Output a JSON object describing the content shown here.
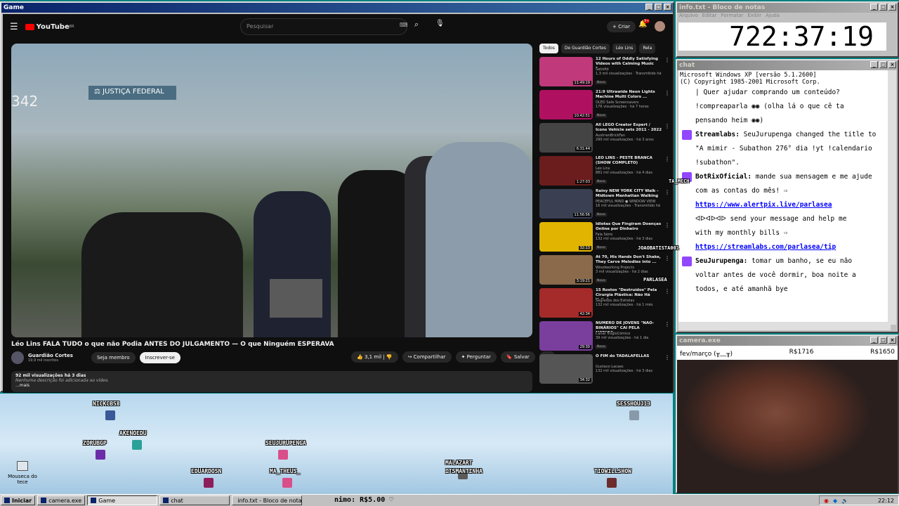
{
  "game_window": {
    "title": "Game"
  },
  "youtube": {
    "logo": "YouTube",
    "region": "BR",
    "search_placeholder": "Pesquisar",
    "create_label": "Criar",
    "notifications": "9+",
    "video_title": "Léo Lins FALA TUDO o que não Podia ANTES DO JULGAMENTO — O que Ninguém ESPERAVA",
    "channel": "Guardião Cortes",
    "subscribers": "19,9 mil inscritos",
    "member_label": "Seja membro",
    "subscribe_label": "Inscrever-se",
    "likes": "3,1 mil",
    "share_label": "Compartilhar",
    "ask_label": "Perguntar",
    "save_label": "Salvar",
    "views_line": "92 mil visualizações  há 3 dias",
    "no_desc": "Nenhuma descrição foi adicionada ao vídeo.",
    "more": "...mais",
    "chips": [
      "Todos",
      "De Guardião Cortes",
      "Léo Lins",
      "Rela"
    ],
    "recs": [
      {
        "title": "12 Hours of Oddly Satisfying Videos with Calming Music for...",
        "channel": "Satisfid",
        "stats": "1,3 mil visualizações · Transmitido há 1 dia",
        "badge": "Novo",
        "duration": "11:49:19",
        "color": "#c0397a"
      },
      {
        "title": "21:9 Ultrawide Neon Lights Machine Multi Colors ...",
        "channel": "OLED Safe Screensavers",
        "stats": "176 visualizações · há 7 horas",
        "badge": "Novo",
        "duration": "10:42:51",
        "color": "#b01060"
      },
      {
        "title": "All LEGO Creator Expert / Icons Vehicle sets 2011 - 2022 ...",
        "channel": "AustrianBrickFan",
        "stats": "290 mil visualizações · há 3 anos",
        "badge": "",
        "duration": "6:31:44",
        "color": "#444"
      },
      {
        "title": "LÉO LINS - PESTE BRANCA (SHOW COMPLETO)",
        "channel": "Léo Lins",
        "stats": "881 mil visualizações · há 4 dias",
        "badge": "Novo",
        "duration": "1:27:03",
        "color": "#6b1d1d"
      },
      {
        "title": "Rainy NEW YORK CITY Walk - Midtown Manhattan Walking ...",
        "channel": "PEACEFUL MIND ● WINDOW VIEW",
        "stats": "16 mil visualizações · Transmitido há 8 h",
        "badge": "Novo",
        "duration": "11:56:56",
        "color": "#3a3f52"
      },
      {
        "title": "Idiotas Que Fingiram Doenças Online por Dinheiro",
        "channel": "Fala Sério",
        "stats": "132 mil visualizações · há 3 dias",
        "badge": "Novo",
        "duration": "32:13",
        "color": "#e0b400"
      },
      {
        "title": "At 70, His Hands Don't Shake, They Carve Melodies into ...",
        "channel": "Woodworking Projects",
        "stats": "3 mil visualizações · há 2 dias",
        "badge": "Novo",
        "duration": "3:19:21",
        "color": "#8a6a4a"
      },
      {
        "title": "15 Rostos \"Destruídos\" Pela Cirurgia Plástica: Não Há Volta!",
        "channel": "Segredos dos Estrelas",
        "stats": "132 mil visualizações · há 1 mês",
        "badge": "",
        "duration": "42:34",
        "color": "#a52a2a"
      },
      {
        "title": "NÚMERO DE JOVENS \"NÃO-BINÁRIOS\" CAI PELA METADE...",
        "channel": "Canal TrogloCômico",
        "stats": "39 mil visualizações · há 1 dia",
        "badge": "Novo",
        "duration": "29:30",
        "color": "#7a3e9d"
      },
      {
        "title": "O FIM do TADALAFELLAS",
        "channel": "Gustavo Lacaes",
        "stats": "132 mil visualizações · há 3 dias",
        "badge": "",
        "duration": "34:32",
        "color": "#555"
      }
    ]
  },
  "notepad": {
    "title": "info.txt - Bloco de notas",
    "menu": [
      "Arquivo",
      "Editar",
      "Formatar",
      "Exibir",
      "Ajuda"
    ],
    "timer": "722:37:19"
  },
  "chat": {
    "title": "chat",
    "header1": "Microsoft Windows XP [versão 5.1.2600]",
    "header2": "(C) Copyright 1985-2001 Microsoft Corp.",
    "l1": "| Quer ajudar comprando um conteúdo?",
    "l2": "!compreaparla ◉◉ (olha lá o que cê ta",
    "l3": "pensando heim ◉◉)",
    "sl_user": "Streamlabs:",
    "sl_msg": " SeuJurupenga changed the title to",
    "sl2": "\"A mimir - Subathon 276° dia !yt !calendario",
    "sl3": "!subathon\".",
    "bot_user": "BotRixOficial:",
    "bot_msg": " mande sua mensagem e me ajude",
    "bot2": "com as contas do mês! ⇨",
    "bot_link": "https://www.alertpix.live/parlasea",
    "bot4": "ᐊᐅᐊᐅᐊᐅ send your message and help me",
    "bot5": "with my monthly bills ⇨",
    "bot_link2": "https://streamlabs.com/parlasea/tip",
    "sj_user": "SeuJurupenga:",
    "sj_msg": " tomar um banho, se eu não",
    "sj2": "voltar antes de você dormir, boa noite a",
    "sj3": "todos, e até amanhã bye"
  },
  "camera": {
    "title": "camera.exe",
    "goal_label": "fev/março (╥﹏╥)",
    "current": "R$1716",
    "goal": "R$1650"
  },
  "stage": {
    "names": [
      "NICKCB58",
      "AKENOEDU",
      "ZORUBGP",
      "SEUJURUPENGA",
      "EDUARDOSN",
      "MA_THEUS_",
      "MALAZART",
      "ITSMANTINHA",
      "TIOWILLSHOW",
      "SESSHOUJ13",
      "TA_MECH",
      "JOAOBATISTA001",
      "PARLASEA"
    ],
    "desk_icon": "Mouseca do tece",
    "min_label": "nimo: R$5.00 ♡"
  },
  "taskbar": {
    "start": "Iniciar",
    "tasks": [
      "camera.exe",
      "Game",
      "chat",
      "info.txt - Bloco de notas"
    ],
    "clock": "22:12"
  }
}
